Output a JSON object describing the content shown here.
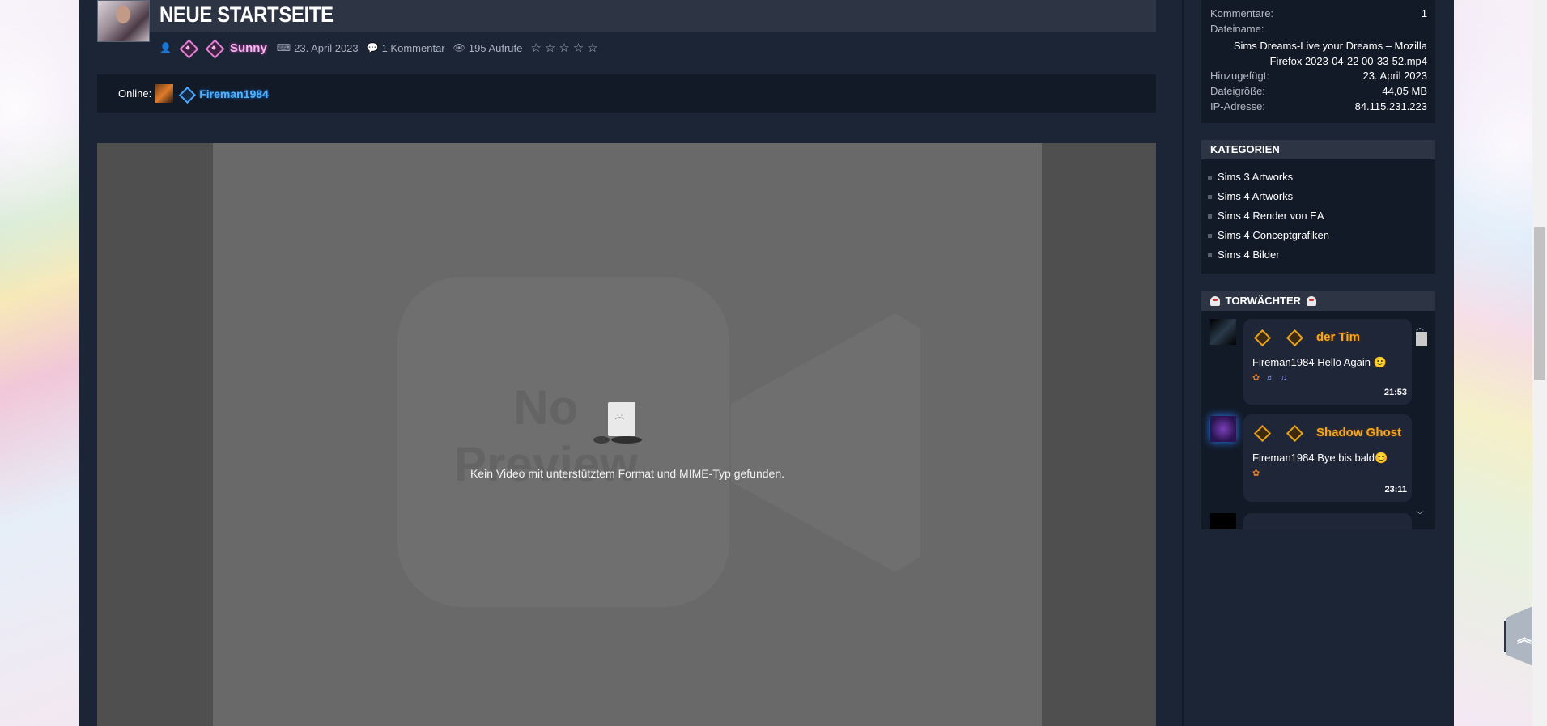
{
  "post": {
    "title": "NEUE STARTSEITE",
    "author": "Sunny",
    "date": "23. April 2023",
    "comments": "1 Kommentar",
    "views": "195 Aufrufe",
    "rating_stars": 5,
    "rating_value": 0
  },
  "online": {
    "label": "Online:",
    "user": "Fireman1984"
  },
  "video": {
    "watermark_line1": "No",
    "watermark_line2": "Preview",
    "error_message": "Kein Video mit unterstütztem Format und MIME-Typ gefunden."
  },
  "info": {
    "comments_label": "Kommentare:",
    "comments_value": "1",
    "filename_label": "Dateiname:",
    "filename_value_line1": "Sims Dreams-Live your Dreams – Mozilla",
    "filename_value_line2": "Firefox 2023-04-22 00-33-52.mp4",
    "added_label": "Hinzugefügt:",
    "added_value": "23. April 2023",
    "size_label": "Dateigröße:",
    "size_value": "44,05 MB",
    "ip_label": "IP-Adresse:",
    "ip_value": "84.115.231.223"
  },
  "categories": {
    "heading": "KATEGORIEN",
    "items": [
      "Sims 3 Artworks",
      "Sims 4 Artworks",
      "Sims 4 Render von EA",
      "Sims 4 Conceptgrafiken",
      "Sims 4 Bilder"
    ]
  },
  "guards": {
    "heading": "TORWÄCHTER",
    "messages": [
      {
        "name": "der Tim",
        "text": "Fireman1984 Hello Again 🙂",
        "time": "21:53"
      },
      {
        "name": "Shadow Ghost",
        "text": "Fireman1984 Bye bis bald😊",
        "time": "23:11"
      }
    ]
  },
  "colors": {
    "site_bg": "#1c2536",
    "panel": "#131a27",
    "header_bar": "#2d3444",
    "author_pink": "#f7b6ef",
    "online_blue": "#4fb4ff",
    "guard_gold": "#f5a623"
  },
  "icons": [
    "user-icon",
    "calendar-icon",
    "comments-icon",
    "eye-icon",
    "star-icon",
    "ghost-icon",
    "scroll-to-top-icon",
    "chevron-up-icon",
    "chevron-down-icon"
  ]
}
